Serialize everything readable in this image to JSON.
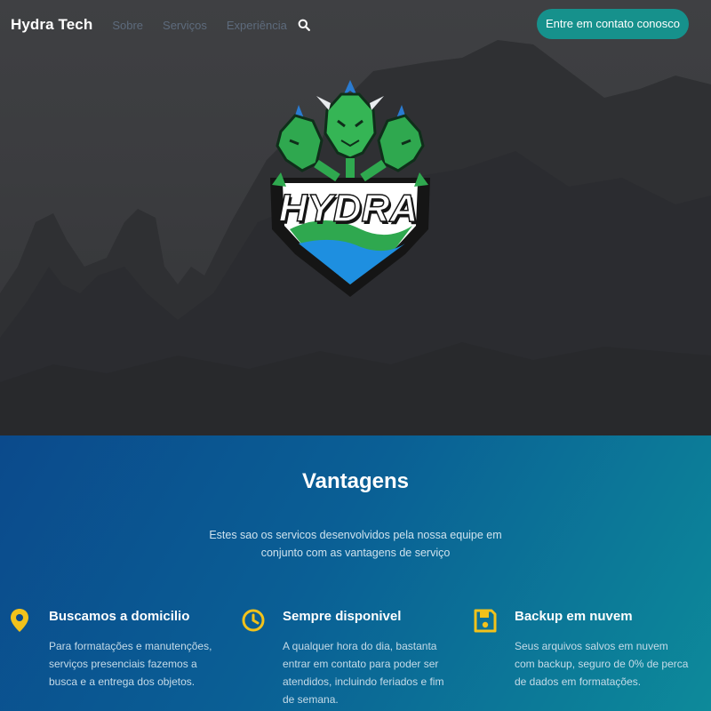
{
  "navbar": {
    "brand": "Hydra Tech",
    "links": [
      "Sobre",
      "Serviços",
      "Experiência"
    ],
    "search_icon": "search-icon",
    "cta_label": "Entre em contato conosco"
  },
  "hero": {
    "logo_text": "HYDRA",
    "logo_icon": "hydra-logo",
    "colors": {
      "logo_green": "#2fa84f",
      "logo_blue": "#1e8fe0",
      "shield_black": "#151515"
    }
  },
  "advantages": {
    "title": "Vantagens",
    "intro": "Estes sao os servicos desenvolvidos pela nossa equipe em conjunto com as vantagens de serviço",
    "items": [
      {
        "icon": "location-pin-icon",
        "title": "Buscamos a domicilio",
        "text": "Para formatações e manutenções, serviços presenciais fazemos a busca e a entrega dos objetos."
      },
      {
        "icon": "clock-icon",
        "title": "Sempre disponivel",
        "text": "A qualquer hora do dia, bastanta entrar em contato para poder ser atendidos, incluindo feriados e fim de semana."
      },
      {
        "icon": "floppy-disk-icon",
        "title": "Backup em nuvem",
        "text": "Seus arquivos salvos em nuvem com backup, seguro de 0% de perca de dados em formatações."
      }
    ]
  },
  "colors": {
    "accent": "#16918c",
    "icon_yellow": "#f2c21b",
    "gradient_start": "#0b4a8c",
    "gradient_end": "#0d8a9a"
  }
}
